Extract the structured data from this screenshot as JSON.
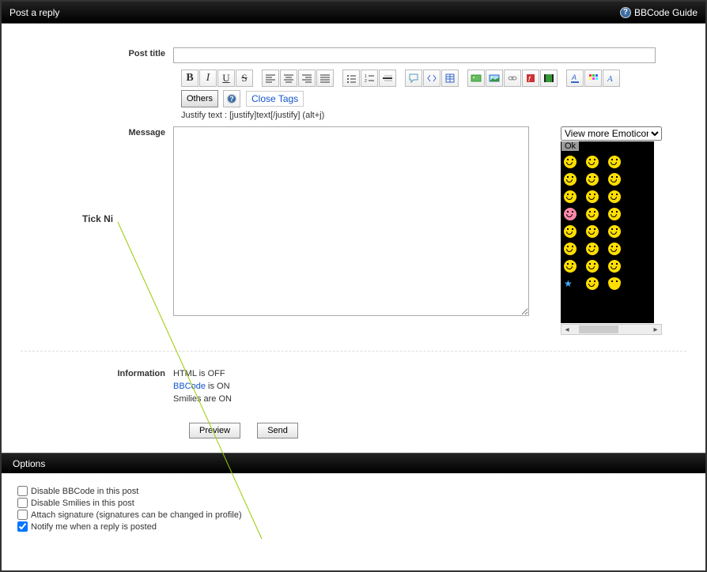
{
  "header": {
    "title": "Post a reply",
    "bbcode_guide": "BBCode Guide"
  },
  "form": {
    "post_title_label": "Post title",
    "post_title_value": "",
    "message_label": "Message",
    "message_value": "",
    "hint_text": "Justify text : [justify]text[/justify] (alt+j)",
    "others_label": "Others",
    "close_tags_label": "Close Tags",
    "preview_label": "Preview",
    "send_label": "Send"
  },
  "emoticons": {
    "dropdown_label": "View more Emoticons",
    "ok_label": "Ok"
  },
  "information": {
    "label": "Information",
    "html_line": "HTML is OFF",
    "bbcode_link": "BBCode",
    "bbcode_suffix": " is ON",
    "smilies_line": "Smilies are ON"
  },
  "options": {
    "header": "Options",
    "opt1": "Disable BBCode in this post",
    "opt2": "Disable Smilies in this post",
    "opt3": "Attach signature (signatures can be changed in profile)",
    "opt4": "Notify me when a reply is posted",
    "opt1_checked": false,
    "opt2_checked": false,
    "opt3_checked": false,
    "opt4_checked": true
  },
  "annotation": {
    "label": "Tick Ni"
  },
  "toolbar_icons": [
    "bold-icon",
    "italic-icon",
    "underline-icon",
    "strike-icon",
    "align-left-icon",
    "align-center-icon",
    "align-right-icon",
    "align-justify-icon",
    "list-unordered-icon",
    "list-ordered-icon",
    "hr-icon",
    "quote-icon",
    "code-icon",
    "table-icon",
    "image-host-icon",
    "image-icon",
    "link-icon",
    "flash-icon",
    "video-icon",
    "font-color-icon",
    "font-palette-icon",
    "font-style-icon"
  ]
}
